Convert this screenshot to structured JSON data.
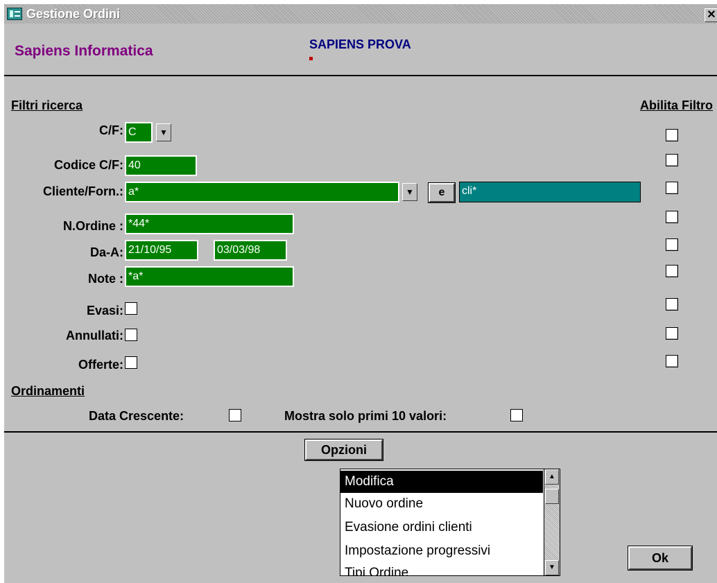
{
  "window": {
    "title": "Gestione Ordini",
    "close": "✕"
  },
  "header": {
    "company": "Sapiens Informatica",
    "database": "SAPIENS PROVA"
  },
  "filters": {
    "section_title": "Filtri ricerca",
    "enable_header": "Abilita Filtro",
    "cf": {
      "label": "C/F:",
      "value": "C"
    },
    "codice_cf": {
      "label": "Codice C/F:",
      "value": "40"
    },
    "cliente_forn": {
      "label": "Cliente/Forn.:",
      "value": "a*",
      "join_button": "e",
      "value2": "cli*"
    },
    "n_ordine": {
      "label": "N.Ordine :",
      "value": "*44*"
    },
    "da_a": {
      "label": "Da-A:",
      "from": "21/10/95",
      "to": "03/03/98"
    },
    "note": {
      "label": "Note :",
      "value": "*a*"
    },
    "evasi": {
      "label": "Evasi:"
    },
    "annullati": {
      "label": "Annullati:"
    },
    "offerte": {
      "label": "Offerte:"
    }
  },
  "sorting": {
    "section_title": "Ordinamenti",
    "data_crescente": "Data Crescente:",
    "mostra_primi": "Mostra solo primi 10 valori:"
  },
  "options": {
    "button": "Opzioni",
    "items": [
      "Modifica",
      "Nuovo ordine",
      "Evasione ordini clienti",
      "Impostazione progressivi",
      "Tipi Ordine"
    ],
    "selected": "Modifica"
  },
  "ok_button": "Ok"
}
